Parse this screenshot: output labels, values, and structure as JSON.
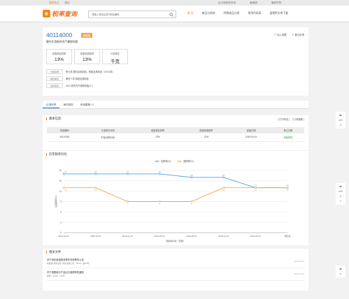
{
  "topbar": {
    "items_left": [
      "",
      "我的关注",
      "退出"
    ],
    "items_right": [
      "出口退税率查询",
      "暖通税",
      "暖税学院"
    ]
  },
  "header": {
    "logo_text": "税率查询",
    "search_placeholder": "请输入商品名称/商品编码",
    "nav": [
      "首 页",
      "商品分类树",
      "特殊商品分类",
      "常用代码表",
      "退税率文库下载"
    ]
  },
  "product": {
    "code": "40114000",
    "badge": "增值税",
    "name": "摩托车用新的充气橡胶轮胎",
    "actions": [
      "加入收藏",
      "登记反馈"
    ],
    "boxes": [
      {
        "label": "增值税征税率",
        "value": "13%"
      },
      {
        "label": "增值税退税率",
        "value": "13%"
      },
      {
        "label": "计量单位",
        "value": "千克"
      }
    ],
    "info": [
      {
        "key": "分类目录",
        "value": "第七类 塑料及其制品；橡胶及其制品（39-40章）"
      },
      {
        "key": "税目类目",
        "value": "第四十章 橡胶及其制品"
      },
      {
        "key": "品目名目",
        "value": "4011 新的充气橡胶轮胎(十)"
      }
    ]
  },
  "tabs": [
    {
      "label": "征退税率",
      "count": ""
    },
    {
      "label": "海关税则",
      "count": ""
    },
    {
      "label": "申报要素",
      "count": "99"
    }
  ],
  "basic": {
    "title": "基本信息",
    "right": [
      "[ 打印本页 ]",
      "[ 订阅更新 ]"
    ],
    "headers": [
      "商品编码",
      "计量单位代码",
      "增值税征税率",
      "增值税退税率",
      "起始日期",
      "禁止日期"
    ],
    "row": [
      "40114000",
      "千克(代码035)",
      "13%",
      "13%",
      "2019-04-01",
      "持续有效"
    ]
  },
  "chart_section_title": "历年税率对比",
  "chart_data": {
    "type": "line",
    "x": [
      "2004-01-01",
      "2005-01-01",
      "2013-01-01",
      "2014-07-01",
      "2018-05-01",
      "2018-11-01",
      "2019-04-01",
      "现阶段"
    ],
    "series": [
      {
        "name": "征税率(%)",
        "color": "#4aa3df",
        "values": [
          17,
          17,
          17,
          17,
          16,
          16,
          13,
          13
        ]
      },
      {
        "name": "退税率(%)",
        "color": "#f0a550",
        "values": [
          13,
          13,
          9,
          9,
          9,
          13,
          13,
          13
        ]
      }
    ],
    "ylim": [
      0,
      18
    ],
    "yticks": [
      0,
      3,
      6,
      9,
      12,
      15,
      18
    ],
    "xlabel": "相关时间点（日期）",
    "ylabel": "征退税率(%)"
  },
  "files": {
    "title": "相关文件",
    "items": [
      {
        "title": "关于深化增值税改革有关政策的公告",
        "meta": "财政部 税务总局 海关总署公告〔2019〕第39号",
        "date": "2019-03-20"
      },
      {
        "title": "关于调整部分产品出口退税率的通知",
        "meta": "财税〔2018〕123号",
        "date": "2018-10-22"
      }
    ]
  },
  "float": {
    "app_label": "APP"
  }
}
